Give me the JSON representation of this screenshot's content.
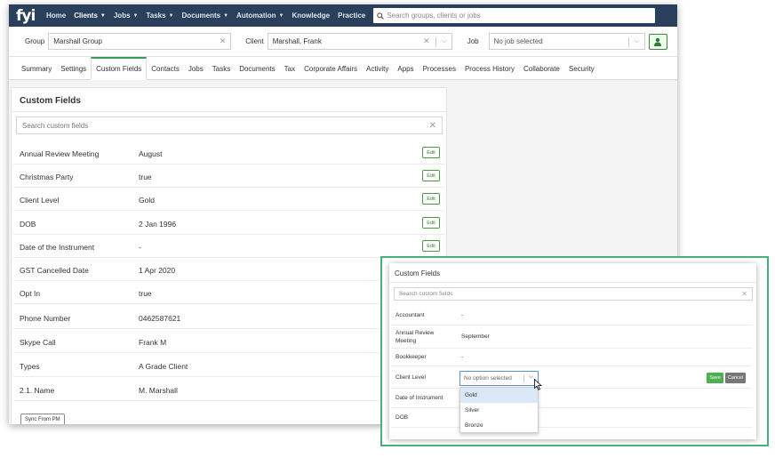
{
  "nav": {
    "logo": "fyi",
    "items": [
      {
        "label": "Home",
        "caret": false,
        "active": false
      },
      {
        "label": "Clients",
        "caret": true,
        "active": true
      },
      {
        "label": "Jobs",
        "caret": true,
        "active": false
      },
      {
        "label": "Tasks",
        "caret": true,
        "active": false
      },
      {
        "label": "Documents",
        "caret": true,
        "active": false
      },
      {
        "label": "Automation",
        "caret": true,
        "active": false
      },
      {
        "label": "Knowledge",
        "caret": false,
        "active": false
      },
      {
        "label": "Practice",
        "caret": false,
        "active": false
      }
    ],
    "search_placeholder": "Search groups, clients or jobs"
  },
  "filters": {
    "group_label": "Group",
    "group_value": "Marshall Group",
    "client_label": "Client",
    "client_value": "Marshall, Frank",
    "job_label": "Job",
    "job_value": "No job selected"
  },
  "tabs": [
    "Summary",
    "Settings",
    "Custom Fields",
    "Contacts",
    "Jobs",
    "Tasks",
    "Documents",
    "Tax",
    "Corporate Affairs",
    "Activity",
    "Apps",
    "Processes",
    "Process History",
    "Collaborate",
    "Security"
  ],
  "active_tab": "Custom Fields",
  "panel": {
    "title": "Custom Fields",
    "search_placeholder": "Search custom fields",
    "edit_label": "Edit",
    "rows": [
      {
        "label": "Annual Review Meeting",
        "value": "August",
        "edit": true
      },
      {
        "label": "Christmas Party",
        "value": "true",
        "edit": true
      },
      {
        "label": "Client Level",
        "value": "Gold",
        "edit": true
      },
      {
        "label": "DOB",
        "value": "2 Jan 1996",
        "edit": true
      },
      {
        "label": "Date of the Instrument",
        "value": "-",
        "edit": true
      },
      {
        "label": "GST Cancelled Date",
        "value": "1 Apr 2020",
        "edit": false
      },
      {
        "label": "Opt In",
        "value": "true",
        "edit": false
      },
      {
        "label": "Phone Number",
        "value": "0462587621",
        "edit": false
      },
      {
        "label": "Skype Call",
        "value": "Frank M",
        "edit": false
      },
      {
        "label": "Types",
        "value": "A Grade Client",
        "edit": false
      },
      {
        "label": "2.1. Name",
        "value": "M. Marshall",
        "edit": false
      }
    ],
    "sync_label": "Sync From PM"
  },
  "overlay": {
    "title": "Custom Fields",
    "search_placeholder": "Search custom fields",
    "rows": [
      {
        "label": "Accountant",
        "value": "-"
      },
      {
        "label": "Annual Review Meeting",
        "value": "September"
      },
      {
        "label": "Bookkeeper",
        "value": "-"
      },
      {
        "label": "Client Level",
        "value": ""
      },
      {
        "label": "Date of Instrument",
        "value": ""
      },
      {
        "label": "DOB",
        "value": ""
      }
    ],
    "select_placeholder": "No option selected",
    "options": [
      "Gold",
      "Silver",
      "Bronze"
    ],
    "highlighted_option": "Gold",
    "save_label": "Save",
    "cancel_label": "Cancel"
  },
  "colors": {
    "nav_bg": "#2a3f5c",
    "accent_green": "#4caf7a",
    "save_green": "#4caf50",
    "cancel_grey": "#777777",
    "select_focus": "#5b8fd6"
  }
}
